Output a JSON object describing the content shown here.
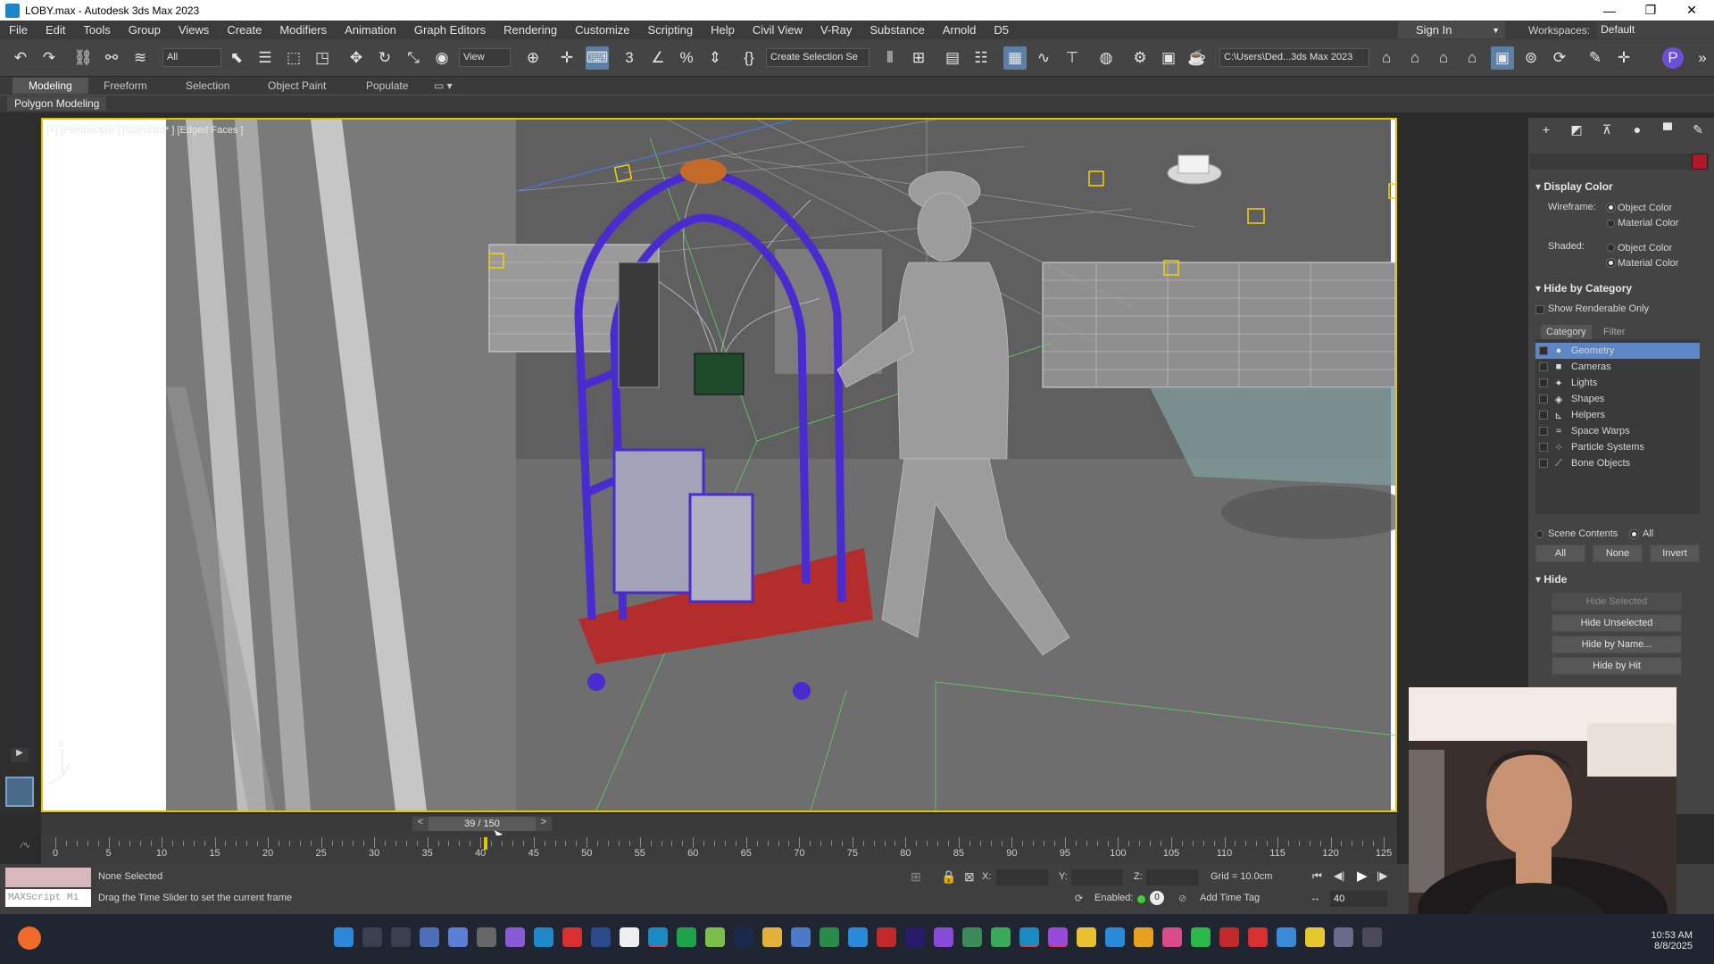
{
  "title_bar": {
    "title": "LOBY.max - Autodesk 3ds Max 2023",
    "minimize": "—",
    "maximize": "❐",
    "close": "✕"
  },
  "menu": [
    "File",
    "Edit",
    "Tools",
    "Group",
    "Views",
    "Create",
    "Modifiers",
    "Animation",
    "Graph Editors",
    "Rendering",
    "Customize",
    "Scripting",
    "Help",
    "Civil View",
    "V-Ray",
    "Substance",
    "Arnold",
    "D5"
  ],
  "signin_label": "Sign In",
  "workspaces": {
    "label": "Workspaces:",
    "value": "Default"
  },
  "toolbar": {
    "filter_select": "All",
    "refcoord_select": "View",
    "selection_set": "Create Selection Se",
    "project_path": "C:\\Users\\Ded...3ds Max 2023"
  },
  "ribbon_tabs": [
    "Modeling",
    "Freeform",
    "Selection",
    "Object Paint",
    "Populate"
  ],
  "ribbon_subtitle": "Polygon Modeling",
  "viewport": {
    "label": "[+] [Perspective ] [Standard* ] [Edged Faces ]"
  },
  "command_panel": {
    "display_color": {
      "title": "Display Color",
      "wireframe_label": "Wireframe:",
      "shaded_label": "Shaded:",
      "object_color": "Object Color",
      "material_color": "Material Color"
    },
    "hide_by_category": {
      "title": "Hide by Category",
      "show_renderable": "Show Renderable Only",
      "tab_category": "Category",
      "tab_filter": "Filter",
      "categories": [
        {
          "label": "Geometry",
          "icon": "sphere-icon"
        },
        {
          "label": "Cameras",
          "icon": "camera-icon"
        },
        {
          "label": "Lights",
          "icon": "light-icon"
        },
        {
          "label": "Shapes",
          "icon": "shape-icon"
        },
        {
          "label": "Helpers",
          "icon": "helper-icon"
        },
        {
          "label": "Space Warps",
          "icon": "spacewarp-icon"
        },
        {
          "label": "Particle Systems",
          "icon": "particle-icon"
        },
        {
          "label": "Bone Objects",
          "icon": "bone-icon"
        }
      ],
      "scene_contents": "Scene Contents",
      "all_radio": "All",
      "btn_all": "All",
      "btn_none": "None",
      "btn_invert": "Invert"
    },
    "hide": {
      "title": "Hide",
      "buttons": [
        "Hide Selected",
        "Hide Unselected",
        "Hide by Name...",
        "Hide by Hit"
      ]
    }
  },
  "time_slider": {
    "value": "39 / 150",
    "prev": "<",
    "next": ">"
  },
  "trackbar_ticks": [
    "0",
    "5",
    "10",
    "15",
    "20",
    "25",
    "30",
    "35",
    "40",
    "45",
    "50",
    "55",
    "60",
    "65",
    "70",
    "75",
    "80",
    "85",
    "90",
    "95",
    "100",
    "105",
    "110",
    "115",
    "120",
    "125"
  ],
  "status": {
    "maxscript": "MAXScript Mi",
    "selection": "None Selected",
    "prompt": "Drag the Time Slider to set the current frame",
    "x_label": "X:",
    "y_label": "Y:",
    "z_label": "Z:",
    "grid": "Grid = 10.0cm",
    "enabled_label": "Enabled:",
    "enabled_value": "0",
    "add_time_tag": "Add Time Tag",
    "frame_field": "40"
  },
  "taskbar": {
    "time": "10:53 AM",
    "date": "8/8/2025"
  },
  "colors": {
    "accent": "#e2c300",
    "selection": "#5d86c4",
    "active_tool": "#5d7fa4",
    "cart_frame": "#4a2bd0",
    "cart_base": "#b32d2d"
  }
}
